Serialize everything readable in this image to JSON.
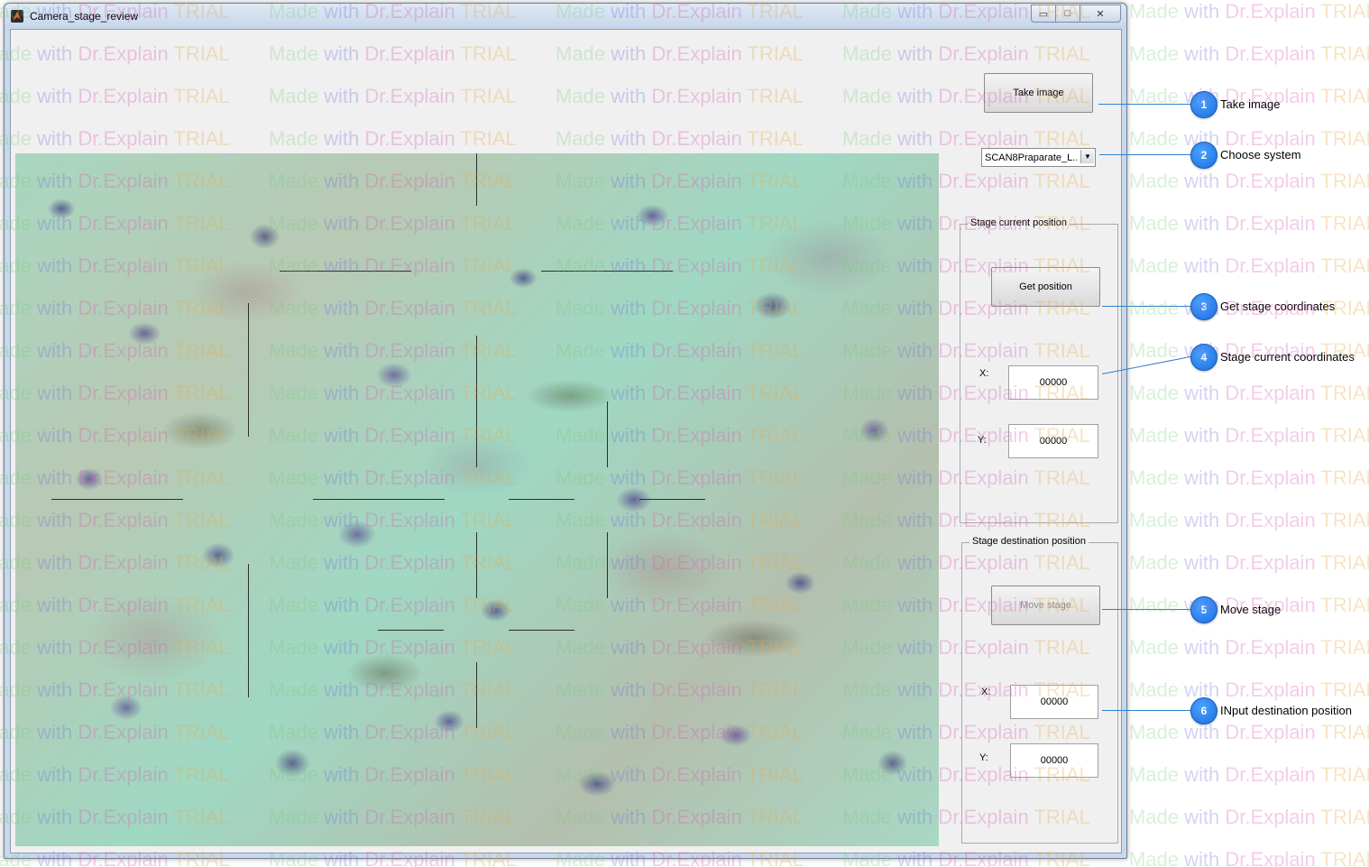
{
  "window": {
    "title": "Camera_stage_review",
    "minimize_label": "▭",
    "maximize_label": "□",
    "close_label": "✕"
  },
  "controls": {
    "take_image_label": "Take image",
    "system_select_value": "SCAN8Praparate_L...",
    "current_group_title": "Stage current position",
    "get_position_label": "Get position",
    "current_x_label": "X:",
    "current_x_value": "00000",
    "current_y_label": "Y:",
    "current_y_value": "00000",
    "destination_group_title": "Stage destination position",
    "move_stage_label": "Move stage",
    "dest_x_label": "X:",
    "dest_x_value": "00000",
    "dest_y_label": "Y:",
    "dest_y_value": "00000"
  },
  "callouts": [
    {
      "number": "1",
      "text": "Take image"
    },
    {
      "number": "2",
      "text": "Choose system"
    },
    {
      "number": "3",
      "text": "Get stage coordinates"
    },
    {
      "number": "4",
      "text": "Stage current coordinates"
    },
    {
      "number": "5",
      "text": "Move stage"
    },
    {
      "number": "6",
      "text": "INput destination position"
    }
  ],
  "watermark": {
    "word1": "Made",
    "word2": "with",
    "word3": "Dr.Explain",
    "word4": "TRIAL"
  },
  "icons": [
    "app-icon",
    "minimize-icon",
    "maximize-icon",
    "close-icon",
    "dropdown-arrow-icon"
  ],
  "colors": {
    "callout_blue": "#1a6ee0",
    "window_frame": "#c9d8ea",
    "client_bg": "#f0f0f0"
  }
}
